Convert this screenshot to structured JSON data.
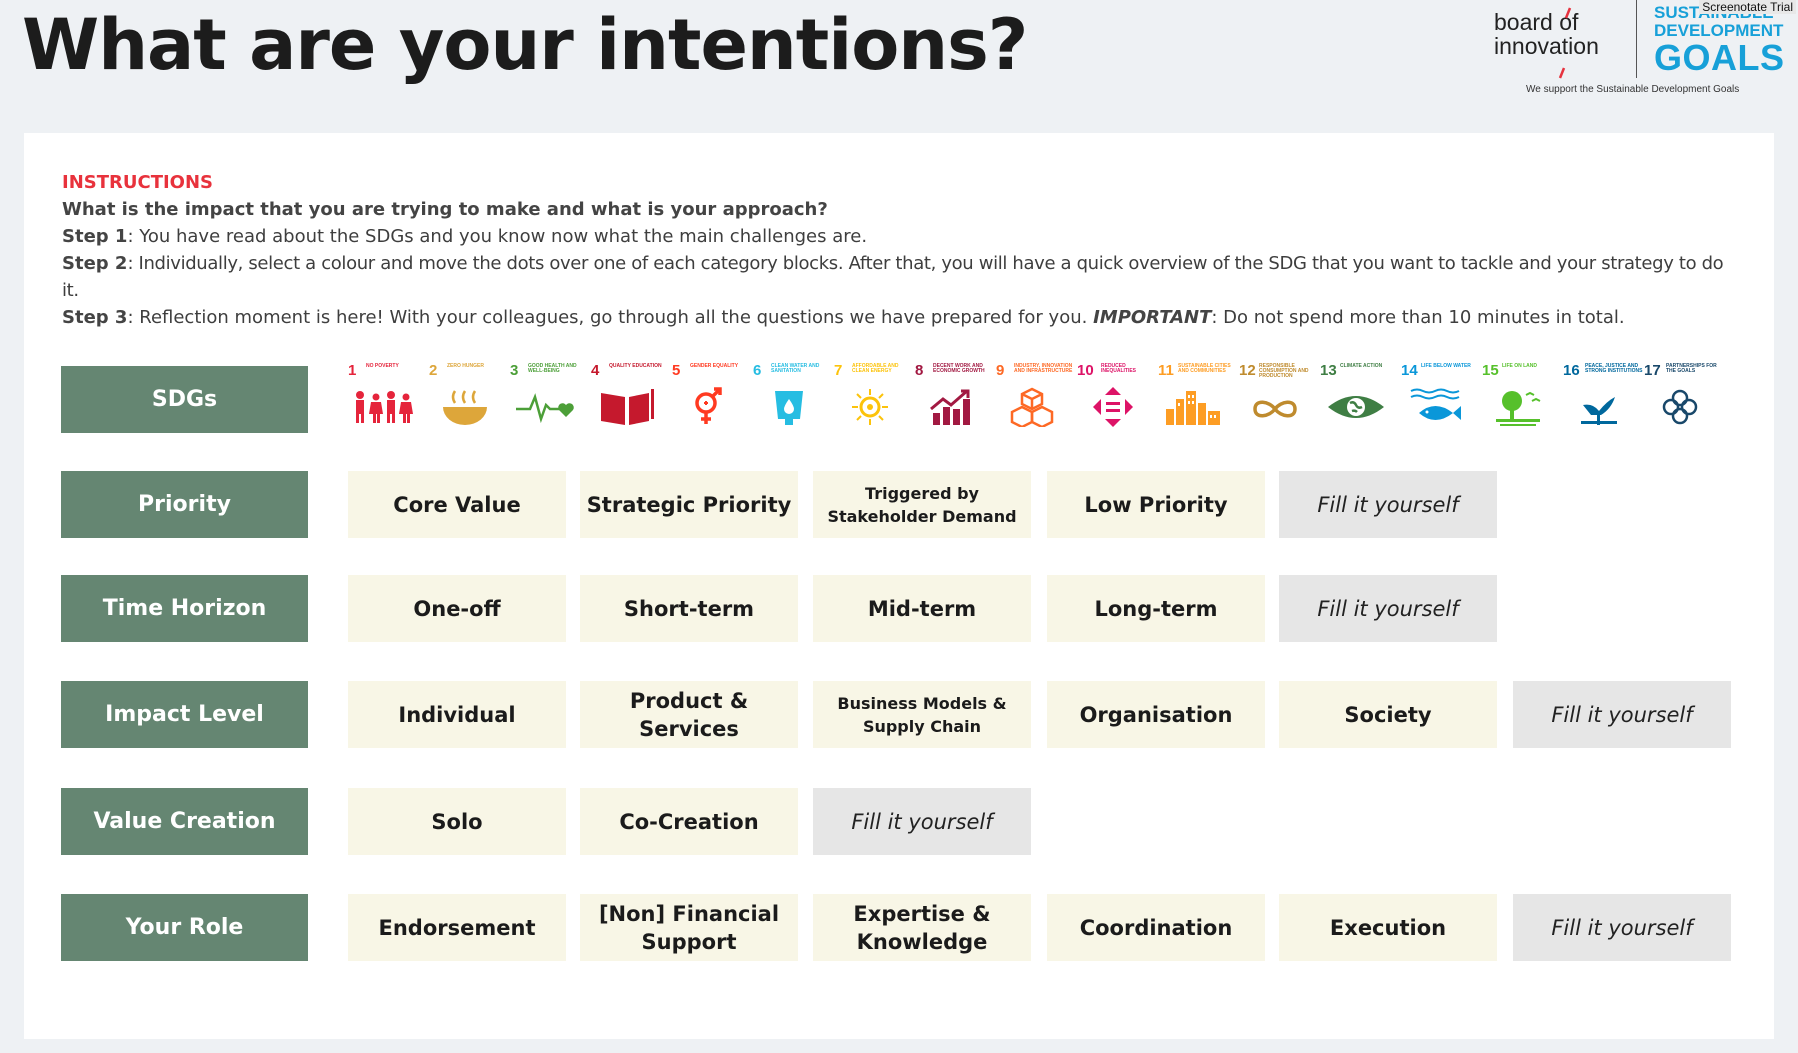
{
  "header": {
    "title": "What are your intentions?",
    "boi_logo": {
      "line1_a": "board ",
      "line1_b": "of",
      "line2_a": "inno",
      "line2_b": "v",
      "line2_c": "ation"
    },
    "sdg_logo": {
      "line1": "SUSTAINABLE",
      "line2": "DEVELOPMENT",
      "line3": "GOALS"
    },
    "support_text": "We support the Sustainable Development Goals",
    "trial_badge": "Screenotate Trial"
  },
  "instructions": {
    "heading": "INSTRUCTIONS",
    "question": "What is the impact that you are trying to make and what is your approach?",
    "step1_label": "Step 1",
    "step1_text": ": You have read about the SDGs and you know now what the main challenges are.",
    "step2_label": "Step 2",
    "step2_text": ": Individually, select a colour and move the dots over one of each category blocks. After that, you will have a quick overview of the SDG that you want to tackle and your strategy to do it.",
    "step3_label": "Step 3",
    "step3_text": ": Reflection moment is here! With your colleagues, go through all the questions we have prepared for you. ",
    "step3_important": "IMPORTANT",
    "step3_text2": ": Do not spend more than 10 minutes in total."
  },
  "colors": {
    "label_green": "#658672",
    "cell_cream": "#f8f6e6",
    "cell_fill_grey": "#e6e6e6",
    "instructions_red": "#e8323c"
  },
  "sdgs": {
    "label": "SDGs",
    "goals": [
      {
        "num": "1",
        "caption": "No poverty",
        "color": "#e5243b",
        "icon": "family-icon"
      },
      {
        "num": "2",
        "caption": "Zero hunger",
        "color": "#dda63a",
        "icon": "bowl-icon"
      },
      {
        "num": "3",
        "caption": "Good health and well-being",
        "color": "#4c9f38",
        "icon": "heartbeat-icon"
      },
      {
        "num": "4",
        "caption": "Quality education",
        "color": "#c5192d",
        "icon": "book-icon"
      },
      {
        "num": "5",
        "caption": "Gender equality",
        "color": "#ff3a21",
        "icon": "gender-icon"
      },
      {
        "num": "6",
        "caption": "Clean water and sanitation",
        "color": "#26bde2",
        "icon": "water-glass-icon"
      },
      {
        "num": "7",
        "caption": "Affordable and clean energy",
        "color": "#fcc30b",
        "icon": "sun-icon"
      },
      {
        "num": "8",
        "caption": "Decent work and economic growth",
        "color": "#a21942",
        "icon": "growth-chart-icon"
      },
      {
        "num": "9",
        "caption": "Industry, innovation and infrastructure",
        "color": "#fd6925",
        "icon": "cubes-icon"
      },
      {
        "num": "10",
        "caption": "Reduced inequalities",
        "color": "#dd1367",
        "icon": "equality-arrows-icon"
      },
      {
        "num": "11",
        "caption": "Sustainable cities and communities",
        "color": "#fd9d24",
        "icon": "city-icon"
      },
      {
        "num": "12",
        "caption": "Responsible consumption and production",
        "color": "#bf8b2e",
        "icon": "infinity-icon"
      },
      {
        "num": "13",
        "caption": "Climate action",
        "color": "#3f7e44",
        "icon": "eye-globe-icon"
      },
      {
        "num": "14",
        "caption": "Life below water",
        "color": "#0a97d9",
        "icon": "fish-icon"
      },
      {
        "num": "15",
        "caption": "Life on land",
        "color": "#56c02b",
        "icon": "tree-icon"
      },
      {
        "num": "16",
        "caption": "Peace, justice and strong institutions",
        "color": "#00689d",
        "icon": "dove-icon"
      },
      {
        "num": "17",
        "caption": "Partnerships for the goals",
        "color": "#19486a",
        "icon": "rings-icon"
      }
    ]
  },
  "rows": {
    "priority": {
      "label": "Priority",
      "options": [
        "Core Value",
        "Strategic Priority",
        "Triggered by Stakeholder Demand",
        "Low Priority"
      ],
      "fill": "Fill it yourself"
    },
    "time_horizon": {
      "label": "Time Horizon",
      "options": [
        "One-off",
        "Short-term",
        "Mid-term",
        "Long-term"
      ],
      "fill": "Fill it yourself"
    },
    "impact_level": {
      "label": "Impact Level",
      "options": [
        "Individual",
        "Product & Services",
        "Business Models & Supply Chain",
        "Organisation",
        "Society"
      ],
      "fill": "Fill it yourself"
    },
    "value_creation": {
      "label": "Value Creation",
      "options": [
        "Solo",
        "Co-Creation"
      ],
      "fill": "Fill it yourself"
    },
    "your_role": {
      "label": "Your Role",
      "options": [
        "Endorsement",
        "[Non] Financial Support",
        "Expertise & Knowledge",
        "Coordination",
        "Execution"
      ],
      "fill": "Fill it yourself"
    }
  }
}
